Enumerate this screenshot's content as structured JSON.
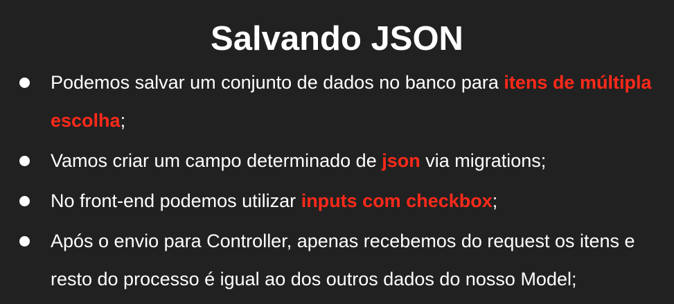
{
  "title": "Salvando JSON",
  "accent_color": "#ff2a1a",
  "background_color": "#212121",
  "bullets": [
    {
      "before": "Podemos salvar um conjunto de dados no banco para ",
      "highlight": "itens de múltipla escolha",
      "after": ";"
    },
    {
      "before": "Vamos criar um campo determinado de ",
      "highlight": "json",
      "after": " via migrations;"
    },
    {
      "before": "No front-end podemos utilizar ",
      "highlight": "inputs com checkbox",
      "after": ";"
    },
    {
      "text": "Após o envio para Controller, apenas recebemos do request os itens e resto do processo é igual ao dos outros dados do nosso Model;"
    }
  ]
}
